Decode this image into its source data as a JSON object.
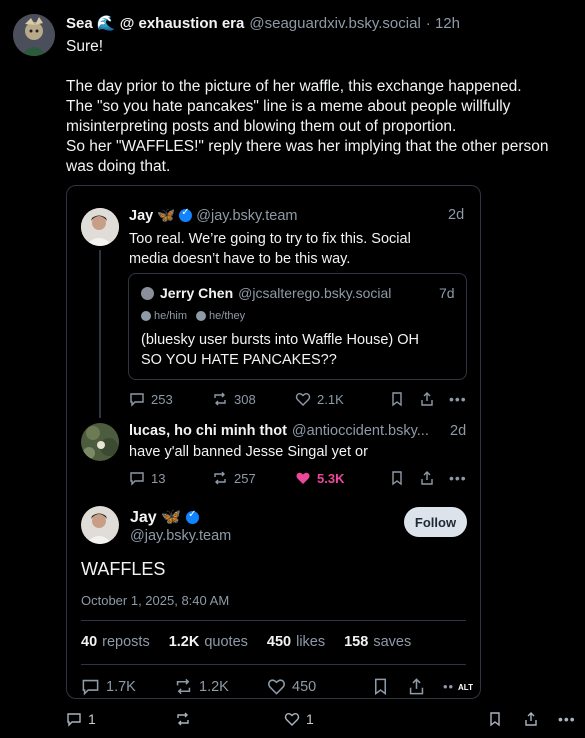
{
  "post": {
    "author_name": "Sea 🌊 @ exhaustion era",
    "handle": "@seaguardxiv.bsky.social",
    "time": "· 12h",
    "text_1": "Sure!",
    "text_2": "The day prior to the picture of her waffle, this exchange happened.",
    "text_3": "The \"so you hate pancakes\" line is a meme about people willfully",
    "text_4": "misinterpreting posts and blowing them out of proportion.",
    "text_5": "So her \"WAFFLES!\" reply there was her implying that the other person",
    "text_6": "was doing that.",
    "reply_count": "1",
    "like_count": "1"
  },
  "embed": {
    "reply1": {
      "name": "Jay 🦋",
      "handle": "@jay.bsky.team",
      "time": "2d",
      "line1": "Too real. We’re going to try to fix this. Social",
      "line2": "media doesn’t have to be this way.",
      "quote": {
        "name": "Jerry Chen",
        "handle": "@jcsalterego.bsky.social",
        "time": "7d",
        "pronoun1": "he/him",
        "pronoun2": "he/they",
        "line1": "(bluesky user bursts into Waffle House) OH",
        "line2": "SO YOU HATE PANCAKES??"
      },
      "replies": "253",
      "reposts": "308",
      "likes": "2.1K"
    },
    "reply2": {
      "name": "lucas, ho chi minh thot",
      "handle": "@antioccident.bsky...",
      "time": "2d",
      "text": "have y'all banned Jesse Singal yet or",
      "replies": "13",
      "reposts": "257",
      "likes": "5.3K"
    },
    "main": {
      "name": "Jay 🦋",
      "handle": "@jay.bsky.team",
      "follow_label": "Follow",
      "text": "WAFFLES",
      "date": "October 1, 2025, 8:40 AM",
      "reposts_num": "40",
      "reposts_label": "reposts",
      "quotes_num": "1.2K",
      "quotes_label": "quotes",
      "likes_num": "450",
      "likes_label": "likes",
      "saves_num": "158",
      "saves_label": "saves",
      "replies": "1.7K",
      "reposts": "1.2K",
      "likes": "450"
    },
    "alt_label": "ALT"
  },
  "colors": {
    "background": "#000000",
    "text": "#f1f3f5",
    "muted": "#8e9aa7",
    "verified": "#1083fe",
    "liked": "#ec4899",
    "border": "#2e3440"
  }
}
